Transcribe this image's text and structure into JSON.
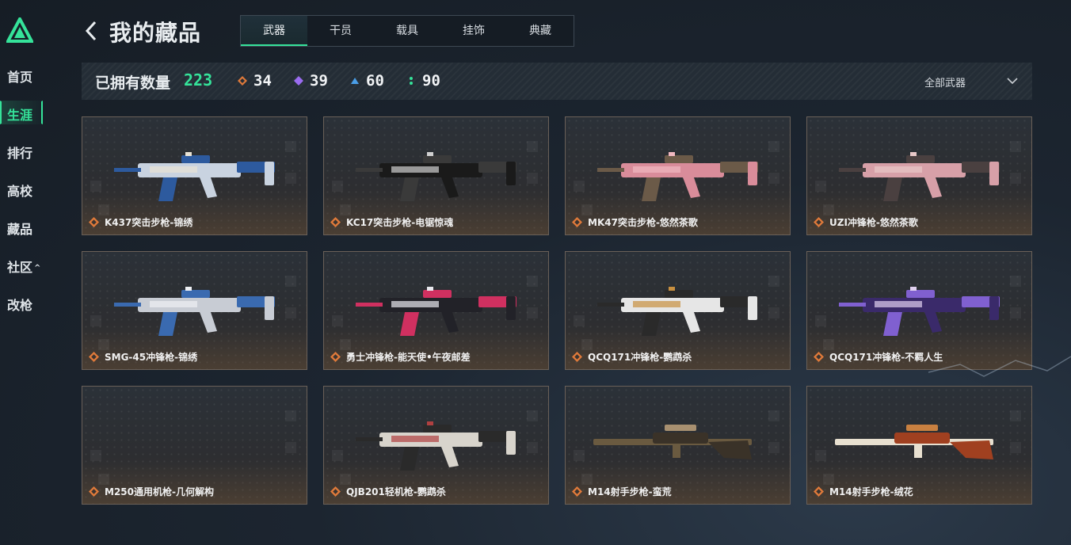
{
  "sidebar": {
    "items": [
      {
        "label": "首页"
      },
      {
        "label": "生涯"
      },
      {
        "label": "排行"
      },
      {
        "label": "高校"
      },
      {
        "label": "藏品"
      },
      {
        "label": "社区"
      },
      {
        "label": "改枪"
      }
    ],
    "community_chevron": "^"
  },
  "header": {
    "title": "我的藏品",
    "tabs": [
      {
        "label": "武器"
      },
      {
        "label": "干员"
      },
      {
        "label": "载具"
      },
      {
        "label": "挂饰"
      },
      {
        "label": "典藏"
      }
    ]
  },
  "stats": {
    "owned_label": "已拥有数量",
    "owned_count": "223",
    "rarities": [
      {
        "icon": "orange-diamond-icon",
        "color": "#e07a3a",
        "count": "34"
      },
      {
        "icon": "purple-diamond-icon",
        "color": "#9a6cf0",
        "count": "39"
      },
      {
        "icon": "blue-triangle-icon",
        "color": "#4a9ee8",
        "count": "60"
      },
      {
        "icon": "green-dots-icon",
        "color": "#35e39a",
        "count": "90"
      }
    ],
    "filter_label": "全部武器"
  },
  "cards": [
    {
      "name": "K437突击步枪-锦绣",
      "icon": "orange-diamond-icon"
    },
    {
      "name": "KC17突击步枪-电锯惊魂",
      "icon": "orange-diamond-icon"
    },
    {
      "name": "MK47突击步枪-悠然茶歌",
      "icon": "orange-diamond-icon"
    },
    {
      "name": "UZI冲锋枪-悠然茶歌",
      "icon": "orange-diamond-icon"
    },
    {
      "name": "SMG-45冲锋枪-锦绣",
      "icon": "orange-diamond-icon"
    },
    {
      "name": "勇士冲锋枪-能天使•午夜邮差",
      "icon": "orange-diamond-icon"
    },
    {
      "name": "QCQ171冲锋枪-鹦鹉杀",
      "icon": "orange-diamond-icon"
    },
    {
      "name": "QCQ171冲锋枪-不羁人生",
      "icon": "orange-diamond-icon"
    },
    {
      "name": "M250通用机枪-几何解构",
      "icon": "orange-diamond-icon"
    },
    {
      "name": "QJB201轻机枪-鹦鹉杀",
      "icon": "orange-diamond-icon"
    },
    {
      "name": "M14射手步枪-蛮荒",
      "icon": "orange-diamond-icon"
    },
    {
      "name": "M14射手步枪-绒花",
      "icon": "orange-diamond-icon"
    }
  ],
  "colors": {
    "accent": "#35e39a",
    "legendary": "#e07a3a"
  }
}
